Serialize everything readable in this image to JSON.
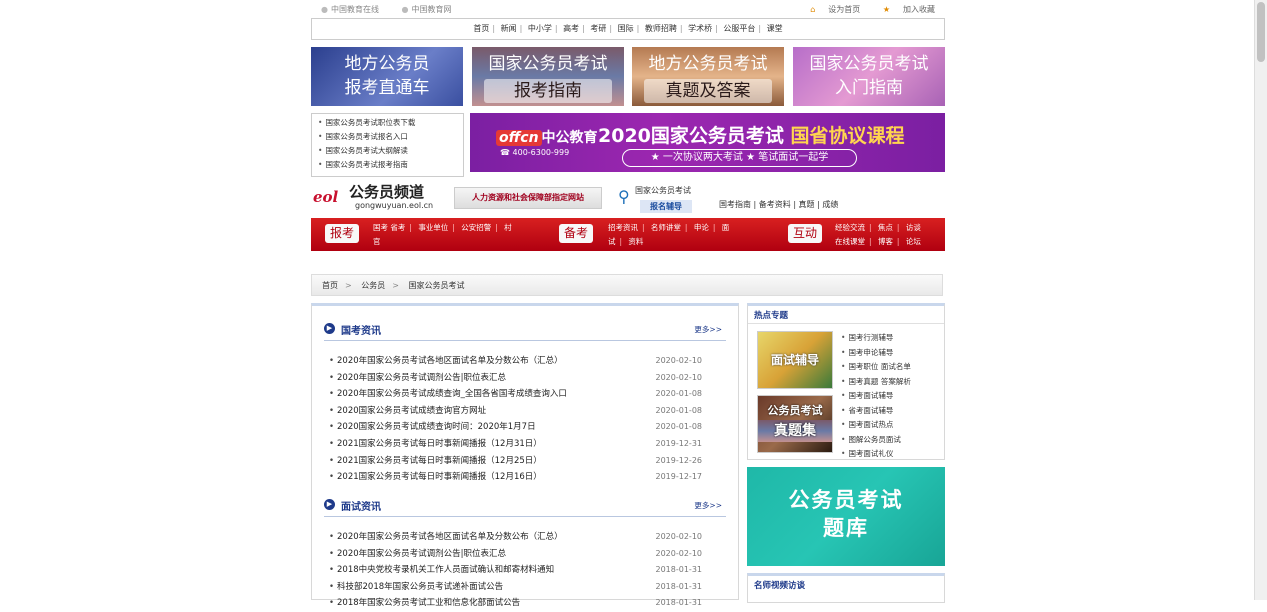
{
  "top": {
    "left_links": [
      "中国教育在线",
      "中国教育网"
    ],
    "right_links": [
      "设为首页",
      "加入收藏"
    ]
  },
  "mainnav": [
    "首页",
    "新闻",
    "中小学",
    "高考",
    "考研",
    "国际",
    "教师招聘",
    "学术桥",
    "公服平台",
    "课堂"
  ],
  "banners": [
    {
      "l1": "地方公务员",
      "l2": "报考直通车"
    },
    {
      "l1": "国家公务员考试",
      "l2": "报考指南"
    },
    {
      "l1": "地方公务员考试",
      "l2": "真题及答案"
    },
    {
      "l1": "国家公务员考试",
      "l2": "入门指南"
    }
  ],
  "quicklinks": [
    "国家公务员考试职位表下载",
    "国家公务员考试报名入口",
    "国家公务员考试大纲解读",
    "国家公务员考试报考指南"
  ],
  "offcn": {
    "logo": "offcn",
    "logo_text": "中公教育",
    "tel": "☎ 400-6300-999",
    "title_a": "2020国家公务员考试",
    "title_b": "国省协议课程",
    "sub": "★ 一次协议两大考试   ★ 笔试面试一起学"
  },
  "channel": {
    "eol": "eol",
    "name": "公务员频道",
    "url": "gongwuyuan.eol.cn",
    "mohrss": "人力资源和社会保障部指定网站",
    "reg_title": "国家公务员考试",
    "reg_button": "报名辅导",
    "guokao_links": "国考指南 | 备考资料 | 真题 | 成绩"
  },
  "rednav": {
    "tag1": "报考",
    "row1a": [
      "国考",
      "省考",
      "|",
      "事业单位",
      "|",
      "公安招警",
      "|",
      "村"
    ],
    "row1b": "官",
    "tag2": "备考",
    "row2a": [
      "招考资讯",
      "|",
      "名师讲堂",
      "|",
      "申论",
      "|",
      "面"
    ],
    "row2b": [
      "试",
      "|",
      "资料"
    ],
    "tag3": "互动",
    "row3a": [
      "经验交流",
      "|",
      "焦点",
      "|",
      "访谈"
    ],
    "row3b": [
      "在线课堂",
      "|",
      "博客",
      "|",
      "论坛"
    ]
  },
  "breadcrumb": [
    "首页",
    "公务员",
    "国家公务员考试"
  ],
  "sections": [
    {
      "title": "国考资讯",
      "more": "更多>>",
      "items": [
        {
          "t": "2020年国家公务员考试各地区面试名单及分数公布（汇总）",
          "d": "2020-02-10"
        },
        {
          "t": "2020年国家公务员考试调剂公告|职位表汇总",
          "d": "2020-02-10"
        },
        {
          "t": "2020年国家公务员考试成绩查询_全国各省国考成绩查询入口",
          "d": "2020-01-08"
        },
        {
          "t": "2020国家公务员考试成绩查询官方网址",
          "d": "2020-01-08"
        },
        {
          "t": "2020国家公务员考试成绩查询时间：2020年1月7日",
          "d": "2020-01-08"
        },
        {
          "t": "2021国家公务员考试每日时事新闻播报（12月31日）",
          "d": "2019-12-31"
        },
        {
          "t": "2021国家公务员考试每日时事新闻播报（12月25日）",
          "d": "2019-12-26"
        },
        {
          "t": "2021国家公务员考试每日时事新闻播报（12月16日）",
          "d": "2019-12-17"
        }
      ]
    },
    {
      "title": "面试资讯",
      "more": "更多>>",
      "items": [
        {
          "t": "2020年国家公务员考试各地区面试名单及分数公布（汇总）",
          "d": "2020-02-10"
        },
        {
          "t": "2020年国家公务员考试调剂公告|职位表汇总",
          "d": "2020-02-10"
        },
        {
          "t": "2018中央党校考录机关工作人员面试确认和邮寄材料通知",
          "d": "2018-01-31"
        },
        {
          "t": "科技部2018年国家公务员考试递补面试公告",
          "d": "2018-01-31"
        },
        {
          "t": "2018年国家公务员考试工业和信息化部面试公告",
          "d": "2018-01-31"
        }
      ]
    }
  ],
  "hot": {
    "title": "热点专题",
    "thumb1": "面试辅导",
    "thumb2_a": "公务员考试",
    "thumb2_b": "真题集",
    "items": [
      "国考行测辅导",
      "国考申论辅导",
      "国考职位 面试名单",
      "国考真题 答案解析",
      "国考面试辅导",
      "省考面试辅导",
      "国考面试热点",
      "图解公务员面试",
      "国考面试礼仪"
    ]
  },
  "qbank": {
    "l1": "公务员考试",
    "l2": "题库"
  },
  "video": {
    "title": "名师视频访谈"
  }
}
